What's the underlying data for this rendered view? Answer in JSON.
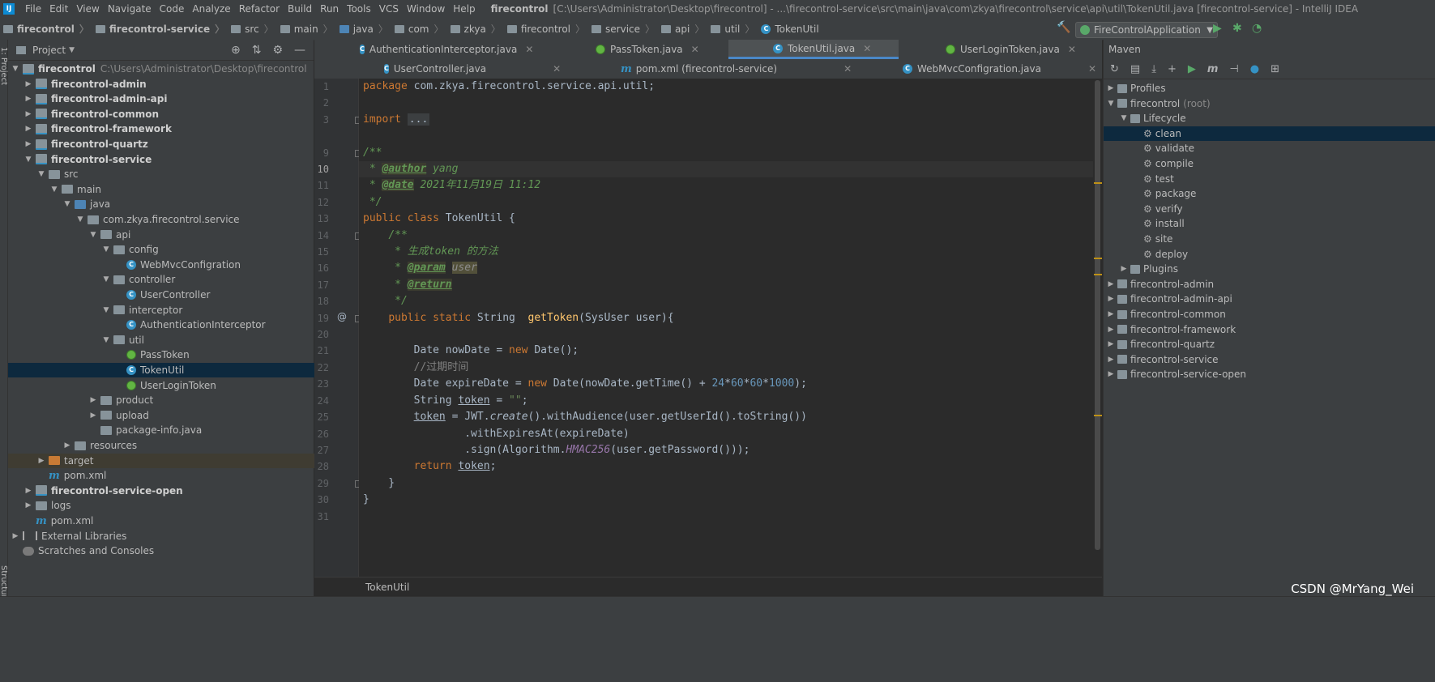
{
  "menubar": {
    "items": [
      "File",
      "Edit",
      "View",
      "Navigate",
      "Code",
      "Analyze",
      "Refactor",
      "Build",
      "Run",
      "Tools",
      "VCS",
      "Window",
      "Help"
    ],
    "project": "firecontrol",
    "path": "[C:\\Users\\Administrator\\Desktop\\firecontrol] - ...\\firecontrol-service\\src\\main\\java\\com\\zkya\\firecontrol\\service\\api\\util\\TokenUtil.java [firecontrol-service] - IntelliJ IDEA"
  },
  "navbar": {
    "crumbs": [
      "firecontrol",
      "firecontrol-service",
      "src",
      "main",
      "java",
      "com",
      "zkya",
      "firecontrol",
      "service",
      "api",
      "util",
      "TokenUtil"
    ],
    "run_config": "FireControlApplication"
  },
  "stripe": {
    "project": "1: Project",
    "structure": "Structure"
  },
  "project_panel": {
    "title": "Project",
    "tree": [
      {
        "label": "firecontrol",
        "extra": "C:\\Users\\Administrator\\Desktop\\firecontrol",
        "depth": 0,
        "arrow": "▼",
        "icon": "module",
        "bold": true
      },
      {
        "label": "firecontrol-admin",
        "depth": 1,
        "arrow": "▶",
        "icon": "module",
        "bold": true
      },
      {
        "label": "firecontrol-admin-api",
        "depth": 1,
        "arrow": "▶",
        "icon": "module",
        "bold": true
      },
      {
        "label": "firecontrol-common",
        "depth": 1,
        "arrow": "▶",
        "icon": "module",
        "bold": true
      },
      {
        "label": "firecontrol-framework",
        "depth": 1,
        "arrow": "▶",
        "icon": "module",
        "bold": true
      },
      {
        "label": "firecontrol-quartz",
        "depth": 1,
        "arrow": "▶",
        "icon": "module",
        "bold": true
      },
      {
        "label": "firecontrol-service",
        "depth": 1,
        "arrow": "▼",
        "icon": "module",
        "bold": true
      },
      {
        "label": "src",
        "depth": 2,
        "arrow": "▼",
        "icon": "folder"
      },
      {
        "label": "main",
        "depth": 3,
        "arrow": "▼",
        "icon": "folder"
      },
      {
        "label": "java",
        "depth": 4,
        "arrow": "▼",
        "icon": "src"
      },
      {
        "label": "com.zkya.firecontrol.service",
        "depth": 5,
        "arrow": "▼",
        "icon": "pkg"
      },
      {
        "label": "api",
        "depth": 6,
        "arrow": "▼",
        "icon": "pkg"
      },
      {
        "label": "config",
        "depth": 7,
        "arrow": "▼",
        "icon": "pkg"
      },
      {
        "label": "WebMvcConfigration",
        "depth": 8,
        "arrow": "",
        "icon": "class"
      },
      {
        "label": "controller",
        "depth": 7,
        "arrow": "▼",
        "icon": "pkg"
      },
      {
        "label": "UserController",
        "depth": 8,
        "arrow": "",
        "icon": "class"
      },
      {
        "label": "interceptor",
        "depth": 7,
        "arrow": "▼",
        "icon": "pkg"
      },
      {
        "label": "AuthenticationInterceptor",
        "depth": 8,
        "arrow": "",
        "icon": "class"
      },
      {
        "label": "util",
        "depth": 7,
        "arrow": "▼",
        "icon": "pkg"
      },
      {
        "label": "PassToken",
        "depth": 8,
        "arrow": "",
        "icon": "spring"
      },
      {
        "label": "TokenUtil",
        "depth": 8,
        "arrow": "",
        "icon": "class",
        "selected": true
      },
      {
        "label": "UserLoginToken",
        "depth": 8,
        "arrow": "",
        "icon": "spring"
      },
      {
        "label": "product",
        "depth": 6,
        "arrow": "▶",
        "icon": "pkg"
      },
      {
        "label": "upload",
        "depth": 6,
        "arrow": "▶",
        "icon": "pkg"
      },
      {
        "label": "package-info.java",
        "depth": 6,
        "arrow": "",
        "icon": "pkg"
      },
      {
        "label": "resources",
        "depth": 4,
        "arrow": "▶",
        "icon": "folder"
      },
      {
        "label": "target",
        "depth": 2,
        "arrow": "▶",
        "icon": "orange",
        "highlight": true
      },
      {
        "label": "pom.xml",
        "depth": 2,
        "arrow": "",
        "icon": "m"
      },
      {
        "label": "firecontrol-service-open",
        "depth": 1,
        "arrow": "▶",
        "icon": "module",
        "bold": true
      },
      {
        "label": "logs",
        "depth": 1,
        "arrow": "▶",
        "icon": "folder"
      },
      {
        "label": "pom.xml",
        "depth": 1,
        "arrow": "",
        "icon": "m"
      },
      {
        "label": "External Libraries",
        "depth": 0,
        "arrow": "▶",
        "icon": "lib"
      },
      {
        "label": "Scratches and Consoles",
        "depth": 0,
        "arrow": "",
        "icon": "scratch"
      }
    ]
  },
  "tabs_row1": [
    {
      "label": "AuthenticationInterceptor.java",
      "icon": "class",
      "active": false
    },
    {
      "label": "PassToken.java",
      "icon": "spring",
      "active": false
    },
    {
      "label": "TokenUtil.java",
      "icon": "class",
      "active": true
    },
    {
      "label": "UserLoginToken.java",
      "icon": "spring",
      "active": false
    }
  ],
  "tabs_row2": [
    {
      "label": "UserController.java",
      "icon": "class"
    },
    {
      "label": "pom.xml (firecontrol-service)",
      "icon": "m"
    },
    {
      "label": "WebMvcConfigration.java",
      "icon": "class"
    }
  ],
  "editor": {
    "line_numbers": [
      "1",
      "2",
      "3",
      "9",
      "10",
      "11",
      "12",
      "13",
      "14",
      "15",
      "16",
      "17",
      "18",
      "19",
      "20",
      "21",
      "22",
      "23",
      "24",
      "25",
      "26",
      "27",
      "28",
      "29",
      "30",
      "31"
    ],
    "current_line": "10",
    "breadcrumb": "TokenUtil",
    "code": [
      "package com.zkya.firecontrol.service.api.util;",
      "",
      "import ...",
      "/**",
      " * @author yang",
      " * @date 2021年11月19日 11:12",
      " */",
      "public class TokenUtil {",
      "    /**",
      "     * 生成token 的方法",
      "     * @param user",
      "     * @return",
      "     */",
      "    public static String  getToken(SysUser user){",
      "",
      "        Date nowDate = new Date();",
      "        //过期时间",
      "        Date expireDate = new Date(nowDate.getTime() + 24*60*60*1000);",
      "        String token = \"\";",
      "        token = JWT.create().withAudience(user.getUserId().toString())",
      "                .withExpiresAt(expireDate)",
      "                .sign(Algorithm.HMAC256(user.getPassword()));",
      "        return token;",
      "    }",
      "}",
      ""
    ]
  },
  "maven": {
    "title": "Maven",
    "tree": [
      {
        "label": "Profiles",
        "depth": 0,
        "arrow": "▶",
        "icon": "folder"
      },
      {
        "label": "firecontrol",
        "extra": "(root)",
        "depth": 0,
        "arrow": "▼",
        "icon": "folder"
      },
      {
        "label": "Lifecycle",
        "depth": 1,
        "arrow": "▼",
        "icon": "folder"
      },
      {
        "label": "clean",
        "depth": 2,
        "arrow": "",
        "icon": "gear",
        "selected": true
      },
      {
        "label": "validate",
        "depth": 2,
        "arrow": "",
        "icon": "gear"
      },
      {
        "label": "compile",
        "depth": 2,
        "arrow": "",
        "icon": "gear"
      },
      {
        "label": "test",
        "depth": 2,
        "arrow": "",
        "icon": "gear"
      },
      {
        "label": "package",
        "depth": 2,
        "arrow": "",
        "icon": "gear"
      },
      {
        "label": "verify",
        "depth": 2,
        "arrow": "",
        "icon": "gear"
      },
      {
        "label": "install",
        "depth": 2,
        "arrow": "",
        "icon": "gear"
      },
      {
        "label": "site",
        "depth": 2,
        "arrow": "",
        "icon": "gear"
      },
      {
        "label": "deploy",
        "depth": 2,
        "arrow": "",
        "icon": "gear"
      },
      {
        "label": "Plugins",
        "depth": 1,
        "arrow": "▶",
        "icon": "folder"
      },
      {
        "label": "firecontrol-admin",
        "depth": 0,
        "arrow": "▶",
        "icon": "folder"
      },
      {
        "label": "firecontrol-admin-api",
        "depth": 0,
        "arrow": "▶",
        "icon": "folder"
      },
      {
        "label": "firecontrol-common",
        "depth": 0,
        "arrow": "▶",
        "icon": "folder"
      },
      {
        "label": "firecontrol-framework",
        "depth": 0,
        "arrow": "▶",
        "icon": "folder"
      },
      {
        "label": "firecontrol-quartz",
        "depth": 0,
        "arrow": "▶",
        "icon": "folder"
      },
      {
        "label": "firecontrol-service",
        "depth": 0,
        "arrow": "▶",
        "icon": "folder"
      },
      {
        "label": "firecontrol-service-open",
        "depth": 0,
        "arrow": "▶",
        "icon": "folder"
      }
    ]
  },
  "watermark": "CSDN @MrYang_Wei"
}
